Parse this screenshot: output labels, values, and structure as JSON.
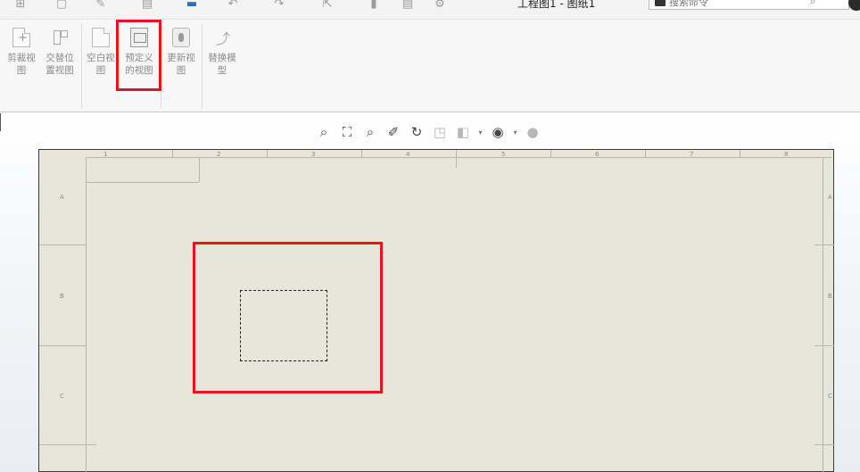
{
  "window": {
    "title": "工程图1 - 图纸1"
  },
  "search": {
    "placeholder": "搜索命令",
    "search_icon": "search-icon"
  },
  "quick_access": [
    {
      "name": "home-icon",
      "glyph": "⊞"
    },
    {
      "name": "new-icon",
      "glyph": "▢"
    },
    {
      "name": "edit-icon",
      "glyph": "✎"
    },
    {
      "name": "save-icon",
      "glyph": "▤"
    },
    {
      "name": "print-icon",
      "glyph": "▬"
    },
    {
      "name": "undo-icon",
      "glyph": "↶"
    },
    {
      "name": "redo-icon",
      "glyph": "↷"
    },
    {
      "name": "select-icon",
      "glyph": "⇱"
    },
    {
      "name": "rebuild-icon",
      "glyph": "▮"
    },
    {
      "name": "file-props-icon",
      "glyph": "▤"
    },
    {
      "name": "options-gear-icon",
      "glyph": "⚙"
    }
  ],
  "ribbon": {
    "buttons": [
      {
        "id": "crop",
        "label": "剪裁视\n图",
        "icon": "crop-view-icon"
      },
      {
        "id": "alternate",
        "label": "交替位\n置视图",
        "icon": "alternate-position-icon"
      },
      {
        "id": "blank",
        "label": "空白视\n图",
        "icon": "blank-view-icon"
      },
      {
        "id": "predefined",
        "label": "预定义\n的视图",
        "icon": "predefined-view-folder-icon",
        "highlighted": true
      },
      {
        "id": "update",
        "label": "更新视\n图",
        "icon": "update-view-icon"
      },
      {
        "id": "replace",
        "label": "替换模\n型",
        "icon": "replace-model-icon"
      }
    ]
  },
  "view_toolbar": [
    {
      "name": "zoom-to-fit-icon",
      "glyph": "⌕",
      "dim": false
    },
    {
      "name": "zoom-to-area-icon",
      "glyph": "⛶",
      "dim": false
    },
    {
      "name": "previous-view-icon",
      "glyph": "⌕",
      "dim": false
    },
    {
      "name": "section-view-icon",
      "glyph": "✐",
      "dim": false
    },
    {
      "name": "rotate-view-icon",
      "glyph": "↻",
      "dim": false
    },
    {
      "name": "view-orientation-icon",
      "glyph": "◳",
      "dim": true
    },
    {
      "name": "display-style-icon",
      "glyph": "◧",
      "dim": true
    },
    {
      "name": "display-style-dropdown-icon",
      "glyph": "▾",
      "dim": true,
      "small": true
    },
    {
      "name": "hide-show-items-icon",
      "glyph": "◉",
      "dim": false
    },
    {
      "name": "hide-show-dropdown-icon",
      "glyph": "▾",
      "dim": false,
      "small": true
    },
    {
      "name": "appearance-icon",
      "glyph": "●",
      "dim": true
    }
  ],
  "sheet": {
    "columns": [
      "1",
      "2",
      "3",
      "4",
      "5",
      "6",
      "7",
      "8"
    ],
    "rows": [
      "A",
      "B",
      "C"
    ]
  },
  "colors": {
    "highlight": "#e8141c",
    "sheet_bg": "#e7e6db"
  }
}
